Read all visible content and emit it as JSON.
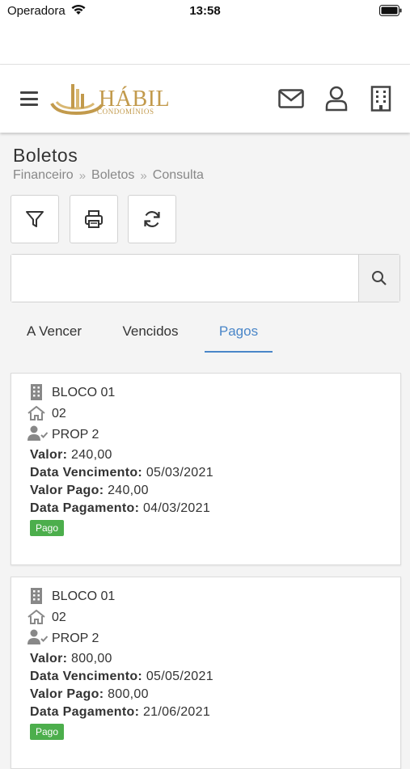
{
  "status_bar": {
    "carrier": "Operadora",
    "time": "13:58"
  },
  "header": {
    "logo_text": "HÁBIL",
    "logo_subtext": "CONDOMÍNIOS",
    "icons": [
      "menu-icon",
      "mail-icon",
      "user-icon",
      "building-icon"
    ]
  },
  "page": {
    "title": "Boletos",
    "breadcrumb": [
      "Financeiro",
      "Boletos",
      "Consulta"
    ]
  },
  "toolbar": {
    "icons": [
      "filter-icon",
      "print-icon",
      "refresh-icon"
    ]
  },
  "search": {
    "value": "",
    "placeholder": ""
  },
  "tabs": [
    {
      "label": "A Vencer",
      "active": false
    },
    {
      "label": "Vencidos",
      "active": false
    },
    {
      "label": "Pagos",
      "active": true
    }
  ],
  "labels": {
    "valor": "Valor:",
    "data_vencimento": "Data Vencimento:",
    "valor_pago": "Valor Pago:",
    "data_pagamento": "Data Pagamento:"
  },
  "boletos": [
    {
      "bloco": "BLOCO 01",
      "unidade": "02",
      "proprietario": "PROP 2",
      "valor": "240,00",
      "data_vencimento": "05/03/2021",
      "valor_pago": "240,00",
      "data_pagamento": "04/03/2021",
      "status": "Pago"
    },
    {
      "bloco": "BLOCO 01",
      "unidade": "02",
      "proprietario": "PROP 2",
      "valor": "800,00",
      "data_vencimento": "05/05/2021",
      "valor_pago": "800,00",
      "data_pagamento": "21/06/2021",
      "status": "Pago"
    }
  ],
  "colors": {
    "accent": "#4a86c8",
    "brand_gold": "#c29a4c",
    "status_paid": "#4cae4c"
  }
}
